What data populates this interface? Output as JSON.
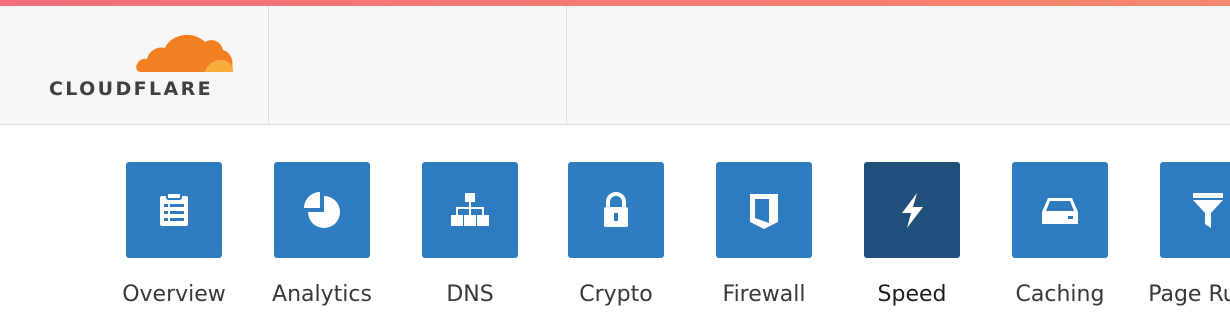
{
  "brand": {
    "name": "CLOUDFLARE",
    "colors": {
      "accent": "#f38020",
      "cloud_light": "#faad3f",
      "tile": "#2f7bbf",
      "tile_active": "#1f4f7a"
    }
  },
  "nav": {
    "items": [
      {
        "label": "Overview",
        "icon": "clipboard-list-icon"
      },
      {
        "label": "Analytics",
        "icon": "pie-chart-icon"
      },
      {
        "label": "DNS",
        "icon": "network-hierarchy-icon"
      },
      {
        "label": "Crypto",
        "icon": "lock-icon"
      },
      {
        "label": "Firewall",
        "icon": "shield-icon"
      },
      {
        "label": "Speed",
        "icon": "lightning-bolt-icon",
        "active": true
      },
      {
        "label": "Caching",
        "icon": "hard-drive-icon"
      },
      {
        "label": "Page Rules",
        "icon": "filter-funnel-icon"
      }
    ]
  }
}
